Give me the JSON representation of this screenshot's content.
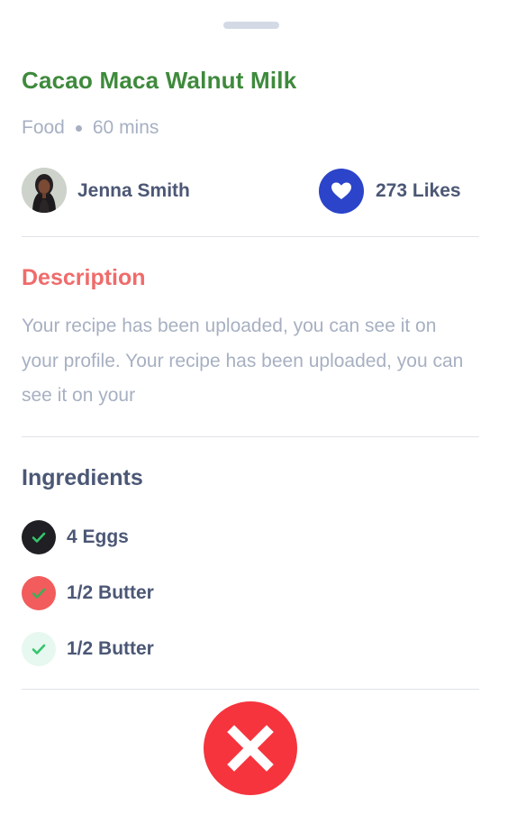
{
  "recipe": {
    "title": "Cacao Maca Walnut Milk",
    "category": "Food",
    "duration": "60 mins"
  },
  "author": {
    "name": "Jenna Smith",
    "avatar_icon": "avatar-photo"
  },
  "likes": {
    "label": "273 Likes",
    "icon": "heart-icon",
    "color": "#2b44c9"
  },
  "description": {
    "heading": "Description",
    "text": "Your recipe has been uploaded, you can see it on your profile. Your recipe has been uploaded, you can see it on your"
  },
  "ingredients": {
    "heading": "Ingredients",
    "items": [
      {
        "label": "4 Eggs",
        "check_style": "dark",
        "color": "#1f1f24"
      },
      {
        "label": "1/2 Butter",
        "check_style": "red",
        "color": "#f25c5c"
      },
      {
        "label": "1/2 Butter",
        "check_style": "mint",
        "color": "#e6f8ef"
      }
    ]
  },
  "actions": {
    "close_icon": "close-icon",
    "close_color": "#f5343d"
  },
  "colors": {
    "title": "#3e8a3c",
    "description_heading": "#f06b6b",
    "ingredients_heading": "#4b5775"
  }
}
